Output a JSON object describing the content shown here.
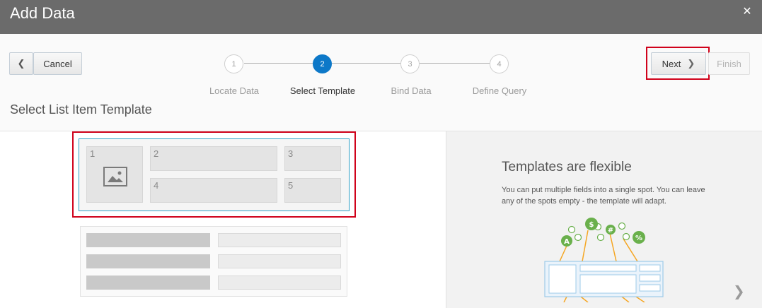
{
  "dialog": {
    "title": "Add Data",
    "close_symbol": "✕"
  },
  "toolbar": {
    "back_symbol": "❮",
    "cancel_label": "Cancel",
    "next_label": "Next",
    "next_symbol": "❯",
    "finish_label": "Finish"
  },
  "steps": [
    {
      "number": "1",
      "label": "Locate Data",
      "active": false
    },
    {
      "number": "2",
      "label": "Select Template",
      "active": true
    },
    {
      "number": "3",
      "label": "Bind Data",
      "active": false
    },
    {
      "number": "4",
      "label": "Define Query",
      "active": false
    }
  ],
  "page": {
    "heading": "Select List Item Template"
  },
  "template_slots": [
    "1",
    "2",
    "3",
    "4",
    "5"
  ],
  "info": {
    "title": "Templates are flexible",
    "text": "You can put multiple fields into a single spot. You can leave any of the spots empty - the template will adapt.",
    "next_symbol": "❯"
  },
  "colors": {
    "accent": "#0d78c8",
    "highlight": "#d0021b",
    "illustration_green": "#6ab04c",
    "illustration_orange": "#f5a623"
  }
}
